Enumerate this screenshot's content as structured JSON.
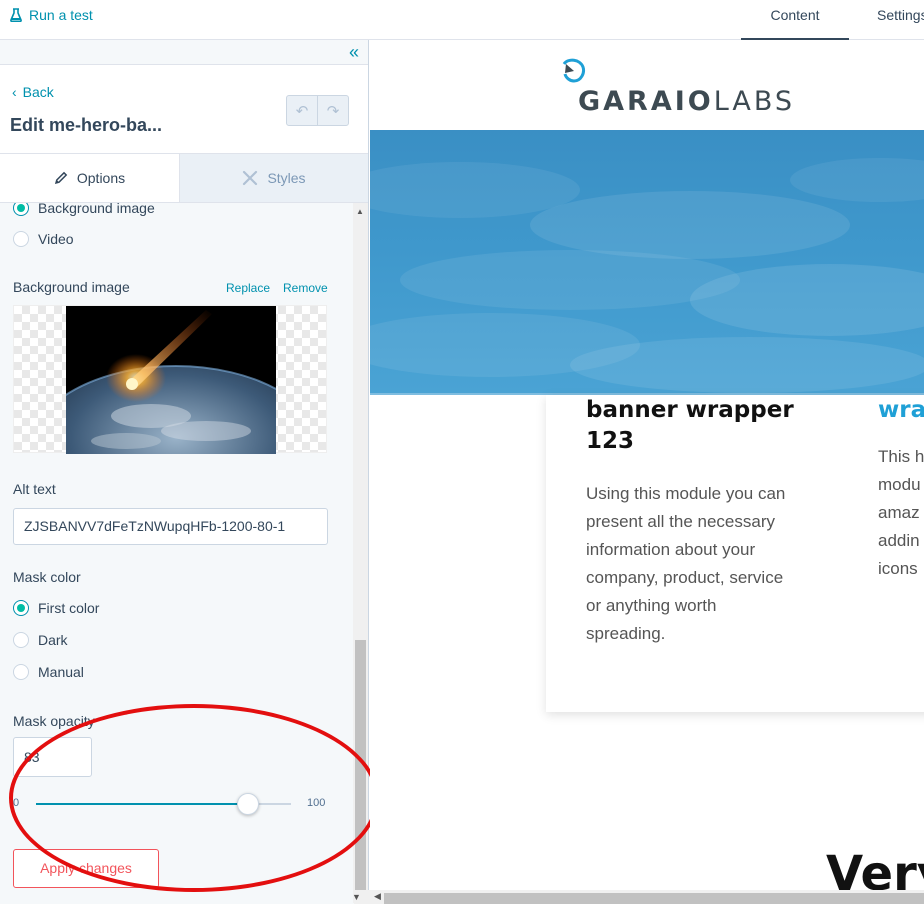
{
  "topbar": {
    "run_test": "Run a test",
    "tab_content": "Content",
    "tab_settings": "Settings"
  },
  "panel": {
    "collapse_icon": "«",
    "back": "Back",
    "title": "Edit me-hero-ba...",
    "tabs": [
      {
        "label": "Options",
        "icon": "pencil-icon",
        "active": true
      },
      {
        "label": "Styles",
        "icon": "styles-icon",
        "active": false
      }
    ],
    "background_type": [
      {
        "label": "Background image",
        "checked": true
      },
      {
        "label": "Video",
        "checked": false
      }
    ],
    "background_image": {
      "label": "Background image",
      "replace": "Replace",
      "remove": "Remove"
    },
    "alt_text": {
      "label": "Alt text",
      "value": "ZJSBANVV7dFeTzNWupqHFb-1200-80-1"
    },
    "mask_color": {
      "label": "Mask color",
      "options": [
        {
          "label": "First color",
          "checked": true
        },
        {
          "label": "Dark",
          "checked": false
        },
        {
          "label": "Manual",
          "checked": false
        }
      ]
    },
    "mask_opacity": {
      "label": "Mask opacity",
      "value": "83",
      "min": "0",
      "max": "100",
      "level": 0.83
    },
    "apply_button": "Apply changes"
  },
  "preview": {
    "logo_bold": "GARAIO",
    "logo_light": "LABS",
    "card_title": "banner wrapper 123",
    "card_text": "Using this module you can present all the necessary information about your company, product, service or anything worth spreading.",
    "col2_title": "wrap",
    "col2_lines": [
      "This h",
      "modu",
      "amaz",
      "addin",
      "icons"
    ],
    "big_word": "Very"
  },
  "colors": {
    "accent": "#0091ae",
    "radio_selected": "#00bda5",
    "apply_button": "#f2545b",
    "annotation": "#e30f0f",
    "hero_sky": "#3f98cc"
  }
}
